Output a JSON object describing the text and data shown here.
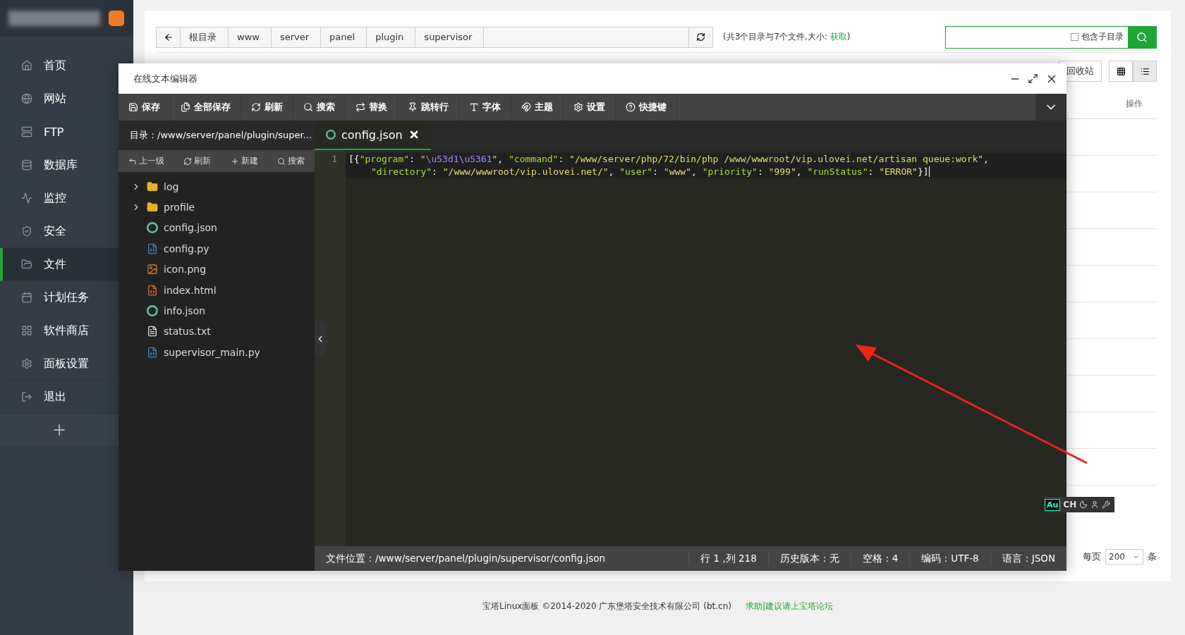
{
  "sidebar": {
    "items": [
      {
        "label": "首页",
        "selected": false
      },
      {
        "label": "网站",
        "selected": false
      },
      {
        "label": "FTP",
        "selected": false
      },
      {
        "label": "数据库",
        "selected": false
      },
      {
        "label": "监控",
        "selected": false
      },
      {
        "label": "安全",
        "selected": false
      },
      {
        "label": "文件",
        "selected": true
      },
      {
        "label": "计划任务",
        "selected": false
      },
      {
        "label": "软件商店",
        "selected": false
      },
      {
        "label": "面板设置",
        "selected": false
      },
      {
        "label": "退出",
        "selected": false
      }
    ],
    "add_button": "+"
  },
  "breadcrumb": [
    "根目录",
    "www",
    "server",
    "panel",
    "plugin",
    "supervisor"
  ],
  "dir_info": {
    "text": "(共3个目录与7个文件,大小: ",
    "link": "获取",
    "close": ")"
  },
  "search": {
    "checkbox_label": "包含子目录",
    "checked": false
  },
  "recycle_button": "回收站",
  "view_modes": [
    {
      "selected": false
    },
    {
      "selected": true
    }
  ],
  "table": {
    "action_header": "操作"
  },
  "pagination": {
    "per_page_label": "每页",
    "per_page": "200",
    "unit": "条"
  },
  "editor": {
    "title": "在线文本编辑器",
    "toolbar": [
      "保存",
      "全部保存",
      "刷新",
      "搜索",
      "替换",
      "跳转行",
      "字体",
      "主题",
      "设置",
      "快捷键"
    ],
    "dir_label": "目录：/www/server/panel/plugin/super...",
    "tree_actions": [
      "上一级",
      "刷新",
      "新建",
      "搜索"
    ],
    "tree": [
      {
        "name": "log",
        "kind": "folder",
        "expanded": false
      },
      {
        "name": "profile",
        "kind": "folder",
        "expanded": false
      },
      {
        "name": "config.json",
        "kind": "json"
      },
      {
        "name": "config.py",
        "kind": "python"
      },
      {
        "name": "icon.png",
        "kind": "image"
      },
      {
        "name": "index.html",
        "kind": "html"
      },
      {
        "name": "info.json",
        "kind": "json"
      },
      {
        "name": "status.txt",
        "kind": "text"
      },
      {
        "name": "supervisor_main.py",
        "kind": "python"
      }
    ],
    "tabs": [
      {
        "label": "config.json",
        "selected": true
      }
    ],
    "code_rows": [
      {
        "kind": "line",
        "number": "1",
        "segments": [
          {
            "kind": "punct",
            "text": "[{"
          },
          {
            "kind": "key",
            "text": "\"program\""
          },
          {
            "kind": "punct",
            "text": ": "
          },
          {
            "kind": "string",
            "text": "\""
          },
          {
            "kind": "escape",
            "text": "\\u53d1\\u5361"
          },
          {
            "kind": "string",
            "text": "\""
          },
          {
            "kind": "punct",
            "text": ", "
          },
          {
            "kind": "key",
            "text": "\"command\""
          },
          {
            "kind": "punct",
            "text": ": "
          },
          {
            "kind": "string",
            "text": "\"/www/server/php/72/bin/php /www/wwwroot/vip.ulovei.net/artisan queue:work\""
          },
          {
            "kind": "punct",
            "text": ","
          }
        ]
      },
      {
        "kind": "wrapped",
        "segments": [
          {
            "kind": "key",
            "text": "\"directory\""
          },
          {
            "kind": "punct",
            "text": ": "
          },
          {
            "kind": "string",
            "text": "\"/www/wwwroot/vip.ulovei.net/\""
          },
          {
            "kind": "punct",
            "text": ", "
          },
          {
            "kind": "key",
            "text": "\"user\""
          },
          {
            "kind": "punct",
            "text": ": "
          },
          {
            "kind": "string",
            "text": "\"www\""
          },
          {
            "kind": "punct",
            "text": ", "
          },
          {
            "kind": "key",
            "text": "\"priority\""
          },
          {
            "kind": "punct",
            "text": ": "
          },
          {
            "kind": "string",
            "text": "\"999\""
          },
          {
            "kind": "punct",
            "text": ", "
          },
          {
            "kind": "key",
            "text": "\"runStatus\""
          },
          {
            "kind": "punct",
            "text": ": "
          },
          {
            "kind": "string",
            "text": "\"ERROR\""
          },
          {
            "kind": "punct",
            "text": "}]"
          }
        ]
      }
    ],
    "status": [
      "文件位置：/www/server/panel/plugin/supervisor/config.json",
      "行 1 ,列 218",
      "历史版本：无",
      "空格：4",
      "编码：UTF-8",
      "语言：JSON"
    ]
  },
  "ime_bar": {
    "badge": "Au",
    "mode": "CH"
  },
  "footer": {
    "copyright": "宝塔Linux面板 ©2014-2020 广东堡塔安全技术有限公司 (bt.cn)",
    "link": "求助|建议请上宝塔论坛"
  }
}
